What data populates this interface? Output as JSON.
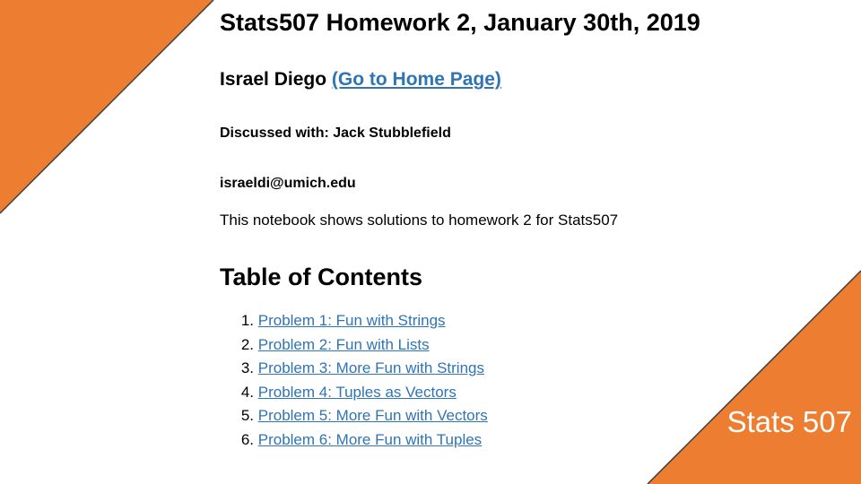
{
  "colors": {
    "accent": "#ed7d31",
    "link": "#2f74b5",
    "edge": "#3c3c3c"
  },
  "document": {
    "title": "Stats507 Homework 2, January 30th, 2019",
    "author": "Israel Diego",
    "home_link": "(Go to Home Page)",
    "discussed_with": "Discussed with: Jack Stubblefield",
    "email": "israeldi@umich.edu",
    "intro": "This notebook shows solutions to homework 2 for Stats507",
    "toc_heading": "Table of Contents",
    "toc": [
      {
        "num": "1.",
        "label": "Problem 1: Fun with Strings"
      },
      {
        "num": "2.",
        "label": "Problem 2: Fun with Lists"
      },
      {
        "num": "3.",
        "label": "Problem 3: More Fun with Strings"
      },
      {
        "num": "4.",
        "label": "Problem 4: Tuples as Vectors"
      },
      {
        "num": "5.",
        "label": "Problem 5: More Fun with Vectors"
      },
      {
        "num": "6.",
        "label": "Problem 6: More Fun with Tuples"
      }
    ]
  },
  "corner_badge": "Stats 507"
}
